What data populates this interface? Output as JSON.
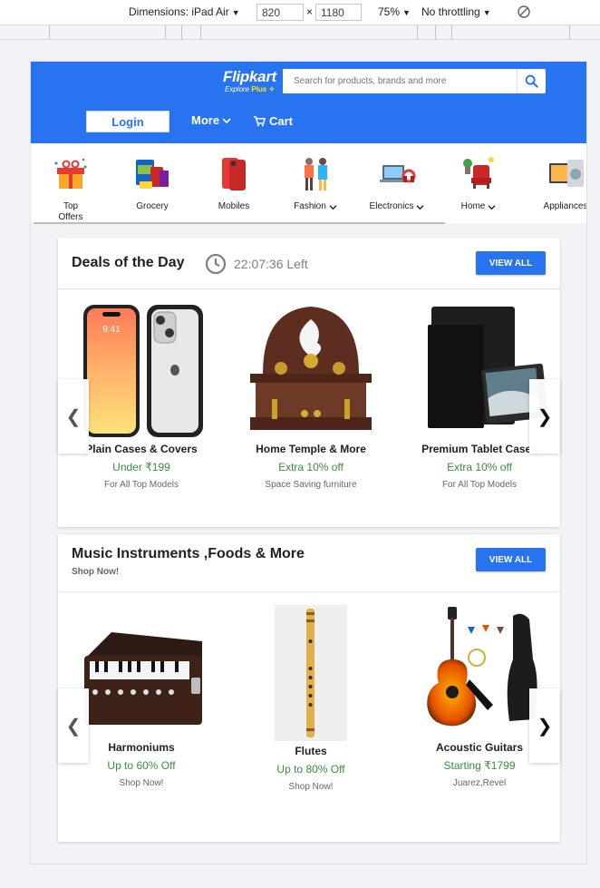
{
  "devtools": {
    "dimensions_label": "Dimensions: iPad Air",
    "width": "820",
    "height": "1180",
    "times": "×",
    "zoom": "75%",
    "throttle": "No throttling"
  },
  "header": {
    "brand": "Flipkart",
    "tagline": "Explore",
    "tagline_plus": "Plus",
    "search_placeholder": "Search for products, brands and more",
    "login_label": "Login",
    "more_label": "More",
    "cart_label": "Cart"
  },
  "categories": [
    {
      "label": "Top Offers",
      "icon": "gift-icon"
    },
    {
      "label": "Grocery",
      "icon": "grocery-icon"
    },
    {
      "label": "Mobiles",
      "icon": "mobile-icon"
    },
    {
      "label": "Fashion",
      "icon": "fashion-icon"
    },
    {
      "label": "Electronics",
      "icon": "electronics-icon"
    },
    {
      "label": "Home",
      "icon": "home-icon"
    },
    {
      "label": "Appliances",
      "icon": "appliances-icon"
    }
  ],
  "deals": {
    "title": "Deals of the Day",
    "timer": "22:07:36 Left",
    "view_all": "VIEW ALL",
    "items": [
      {
        "name": "Plain Cases & Covers",
        "offer": "Under ₹199",
        "desc": "For All Top Models"
      },
      {
        "name": "Home Temple & More",
        "offer": "Extra 10% off",
        "desc": "Space Saving furniture"
      },
      {
        "name": "Premium Tablet Cases",
        "offer": "Extra 10% off",
        "desc": "For All Top Models"
      }
    ]
  },
  "music": {
    "title": "Music Instruments ,Foods & More",
    "subtitle": "Shop Now!",
    "view_all": "VIEW ALL",
    "items": [
      {
        "name": "Harmoniums",
        "offer": "Up to 60% Off",
        "desc": "Shop Now!"
      },
      {
        "name": "Flutes",
        "offer": "Up to 80% Off",
        "desc": "Shop Now!"
      },
      {
        "name": "Acoustic Guitars",
        "offer": "Starting ₹1799",
        "desc": "Juarez,Revel"
      }
    ]
  },
  "colors": {
    "brand_blue": "#2874f0",
    "offer_green": "#388e3c",
    "tagline_yellow": "#ffe500"
  }
}
